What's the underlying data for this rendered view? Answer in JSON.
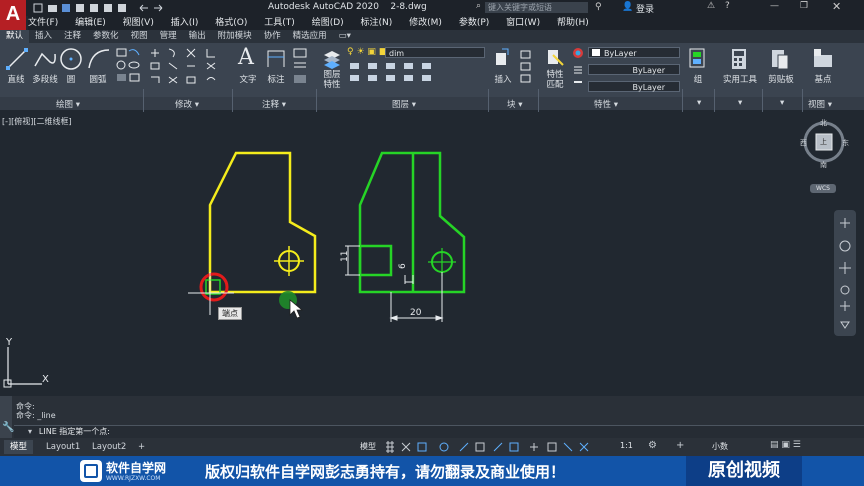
{
  "app": {
    "title": "Autodesk AutoCAD 2020",
    "filename": "2-8.dwg",
    "search_placeholder": "键入关键字或短语",
    "login": "登录",
    "logo": "A"
  },
  "menu": [
    "文件(F)",
    "编辑(E)",
    "视图(V)",
    "插入(I)",
    "格式(O)",
    "工具(T)",
    "绘图(D)",
    "标注(N)",
    "修改(M)",
    "参数(P)",
    "窗口(W)",
    "帮助(H)"
  ],
  "ribbon_tabs": [
    "默认",
    "插入",
    "注释",
    "参数化",
    "视图",
    "管理",
    "输出",
    "附加模块",
    "协作",
    "精选应用"
  ],
  "ribbon_tools": {
    "line": "直线",
    "polyline": "多段线",
    "circle": "圆",
    "arc": "圆弧",
    "text": "文字",
    "dim": "标注",
    "layer_props": "图层\n特性",
    "insert": "插入",
    "match_props": "特性\n匹配",
    "group": "组",
    "utilities": "实用工具",
    "clipboard": "剪贴板",
    "base": "基点"
  },
  "layer_combo": "dim",
  "property_combos": [
    "ByLayer",
    "ByLayer",
    "ByLayer"
  ],
  "panel_labels": [
    "绘图",
    "修改",
    "注释",
    "图层",
    "块",
    "特性",
    "视图"
  ],
  "viewport": {
    "label": "[-][俯视][二维线框]",
    "snap_tooltip": "端点",
    "viewcube": {
      "north": "北",
      "south": "南",
      "east": "东",
      "west": "西",
      "top": "上",
      "wcs": "WCS"
    },
    "dims": {
      "d11": "11",
      "d6": "6",
      "d20": "20"
    },
    "ucs": {
      "x": "X",
      "y": "Y"
    },
    "colors": {
      "yellow": "#f4ec1c",
      "green": "#26d426",
      "red": "#e21b1b"
    }
  },
  "command": {
    "history": [
      "命令:",
      "命令: _line"
    ],
    "prompt": "LINE 指定第一个点:"
  },
  "layout_tabs": [
    "模型",
    "Layout1",
    "Layout2"
  ],
  "status": {
    "model": "模型",
    "scale": "1:1",
    "units": "小数"
  },
  "banner": {
    "logo_text": "软件自学网",
    "logo_sub": "WWW.RJZXW.COM",
    "notice": "版权归软件自学网彭志勇持有，请勿翻录及商业使用！",
    "badge": "原创视频"
  }
}
